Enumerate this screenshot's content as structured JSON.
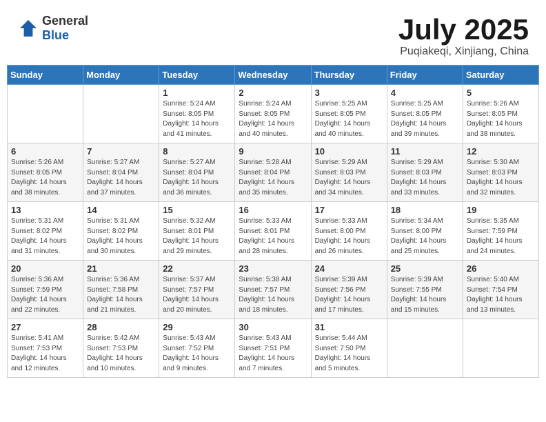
{
  "header": {
    "logo_general": "General",
    "logo_blue": "Blue",
    "month_title": "July 2025",
    "location": "Puqiakeqi, Xinjiang, China"
  },
  "weekdays": [
    "Sunday",
    "Monday",
    "Tuesday",
    "Wednesday",
    "Thursday",
    "Friday",
    "Saturday"
  ],
  "weeks": [
    [
      {
        "day": "",
        "info": ""
      },
      {
        "day": "",
        "info": ""
      },
      {
        "day": "1",
        "info": "Sunrise: 5:24 AM\nSunset: 8:05 PM\nDaylight: 14 hours and 41 minutes."
      },
      {
        "day": "2",
        "info": "Sunrise: 5:24 AM\nSunset: 8:05 PM\nDaylight: 14 hours and 40 minutes."
      },
      {
        "day": "3",
        "info": "Sunrise: 5:25 AM\nSunset: 8:05 PM\nDaylight: 14 hours and 40 minutes."
      },
      {
        "day": "4",
        "info": "Sunrise: 5:25 AM\nSunset: 8:05 PM\nDaylight: 14 hours and 39 minutes."
      },
      {
        "day": "5",
        "info": "Sunrise: 5:26 AM\nSunset: 8:05 PM\nDaylight: 14 hours and 38 minutes."
      }
    ],
    [
      {
        "day": "6",
        "info": "Sunrise: 5:26 AM\nSunset: 8:05 PM\nDaylight: 14 hours and 38 minutes."
      },
      {
        "day": "7",
        "info": "Sunrise: 5:27 AM\nSunset: 8:04 PM\nDaylight: 14 hours and 37 minutes."
      },
      {
        "day": "8",
        "info": "Sunrise: 5:27 AM\nSunset: 8:04 PM\nDaylight: 14 hours and 36 minutes."
      },
      {
        "day": "9",
        "info": "Sunrise: 5:28 AM\nSunset: 8:04 PM\nDaylight: 14 hours and 35 minutes."
      },
      {
        "day": "10",
        "info": "Sunrise: 5:29 AM\nSunset: 8:03 PM\nDaylight: 14 hours and 34 minutes."
      },
      {
        "day": "11",
        "info": "Sunrise: 5:29 AM\nSunset: 8:03 PM\nDaylight: 14 hours and 33 minutes."
      },
      {
        "day": "12",
        "info": "Sunrise: 5:30 AM\nSunset: 8:03 PM\nDaylight: 14 hours and 32 minutes."
      }
    ],
    [
      {
        "day": "13",
        "info": "Sunrise: 5:31 AM\nSunset: 8:02 PM\nDaylight: 14 hours and 31 minutes."
      },
      {
        "day": "14",
        "info": "Sunrise: 5:31 AM\nSunset: 8:02 PM\nDaylight: 14 hours and 30 minutes."
      },
      {
        "day": "15",
        "info": "Sunrise: 5:32 AM\nSunset: 8:01 PM\nDaylight: 14 hours and 29 minutes."
      },
      {
        "day": "16",
        "info": "Sunrise: 5:33 AM\nSunset: 8:01 PM\nDaylight: 14 hours and 28 minutes."
      },
      {
        "day": "17",
        "info": "Sunrise: 5:33 AM\nSunset: 8:00 PM\nDaylight: 14 hours and 26 minutes."
      },
      {
        "day": "18",
        "info": "Sunrise: 5:34 AM\nSunset: 8:00 PM\nDaylight: 14 hours and 25 minutes."
      },
      {
        "day": "19",
        "info": "Sunrise: 5:35 AM\nSunset: 7:59 PM\nDaylight: 14 hours and 24 minutes."
      }
    ],
    [
      {
        "day": "20",
        "info": "Sunrise: 5:36 AM\nSunset: 7:59 PM\nDaylight: 14 hours and 22 minutes."
      },
      {
        "day": "21",
        "info": "Sunrise: 5:36 AM\nSunset: 7:58 PM\nDaylight: 14 hours and 21 minutes."
      },
      {
        "day": "22",
        "info": "Sunrise: 5:37 AM\nSunset: 7:57 PM\nDaylight: 14 hours and 20 minutes."
      },
      {
        "day": "23",
        "info": "Sunrise: 5:38 AM\nSunset: 7:57 PM\nDaylight: 14 hours and 18 minutes."
      },
      {
        "day": "24",
        "info": "Sunrise: 5:39 AM\nSunset: 7:56 PM\nDaylight: 14 hours and 17 minutes."
      },
      {
        "day": "25",
        "info": "Sunrise: 5:39 AM\nSunset: 7:55 PM\nDaylight: 14 hours and 15 minutes."
      },
      {
        "day": "26",
        "info": "Sunrise: 5:40 AM\nSunset: 7:54 PM\nDaylight: 14 hours and 13 minutes."
      }
    ],
    [
      {
        "day": "27",
        "info": "Sunrise: 5:41 AM\nSunset: 7:53 PM\nDaylight: 14 hours and 12 minutes."
      },
      {
        "day": "28",
        "info": "Sunrise: 5:42 AM\nSunset: 7:53 PM\nDaylight: 14 hours and 10 minutes."
      },
      {
        "day": "29",
        "info": "Sunrise: 5:43 AM\nSunset: 7:52 PM\nDaylight: 14 hours and 9 minutes."
      },
      {
        "day": "30",
        "info": "Sunrise: 5:43 AM\nSunset: 7:51 PM\nDaylight: 14 hours and 7 minutes."
      },
      {
        "day": "31",
        "info": "Sunrise: 5:44 AM\nSunset: 7:50 PM\nDaylight: 14 hours and 5 minutes."
      },
      {
        "day": "",
        "info": ""
      },
      {
        "day": "",
        "info": ""
      }
    ]
  ]
}
